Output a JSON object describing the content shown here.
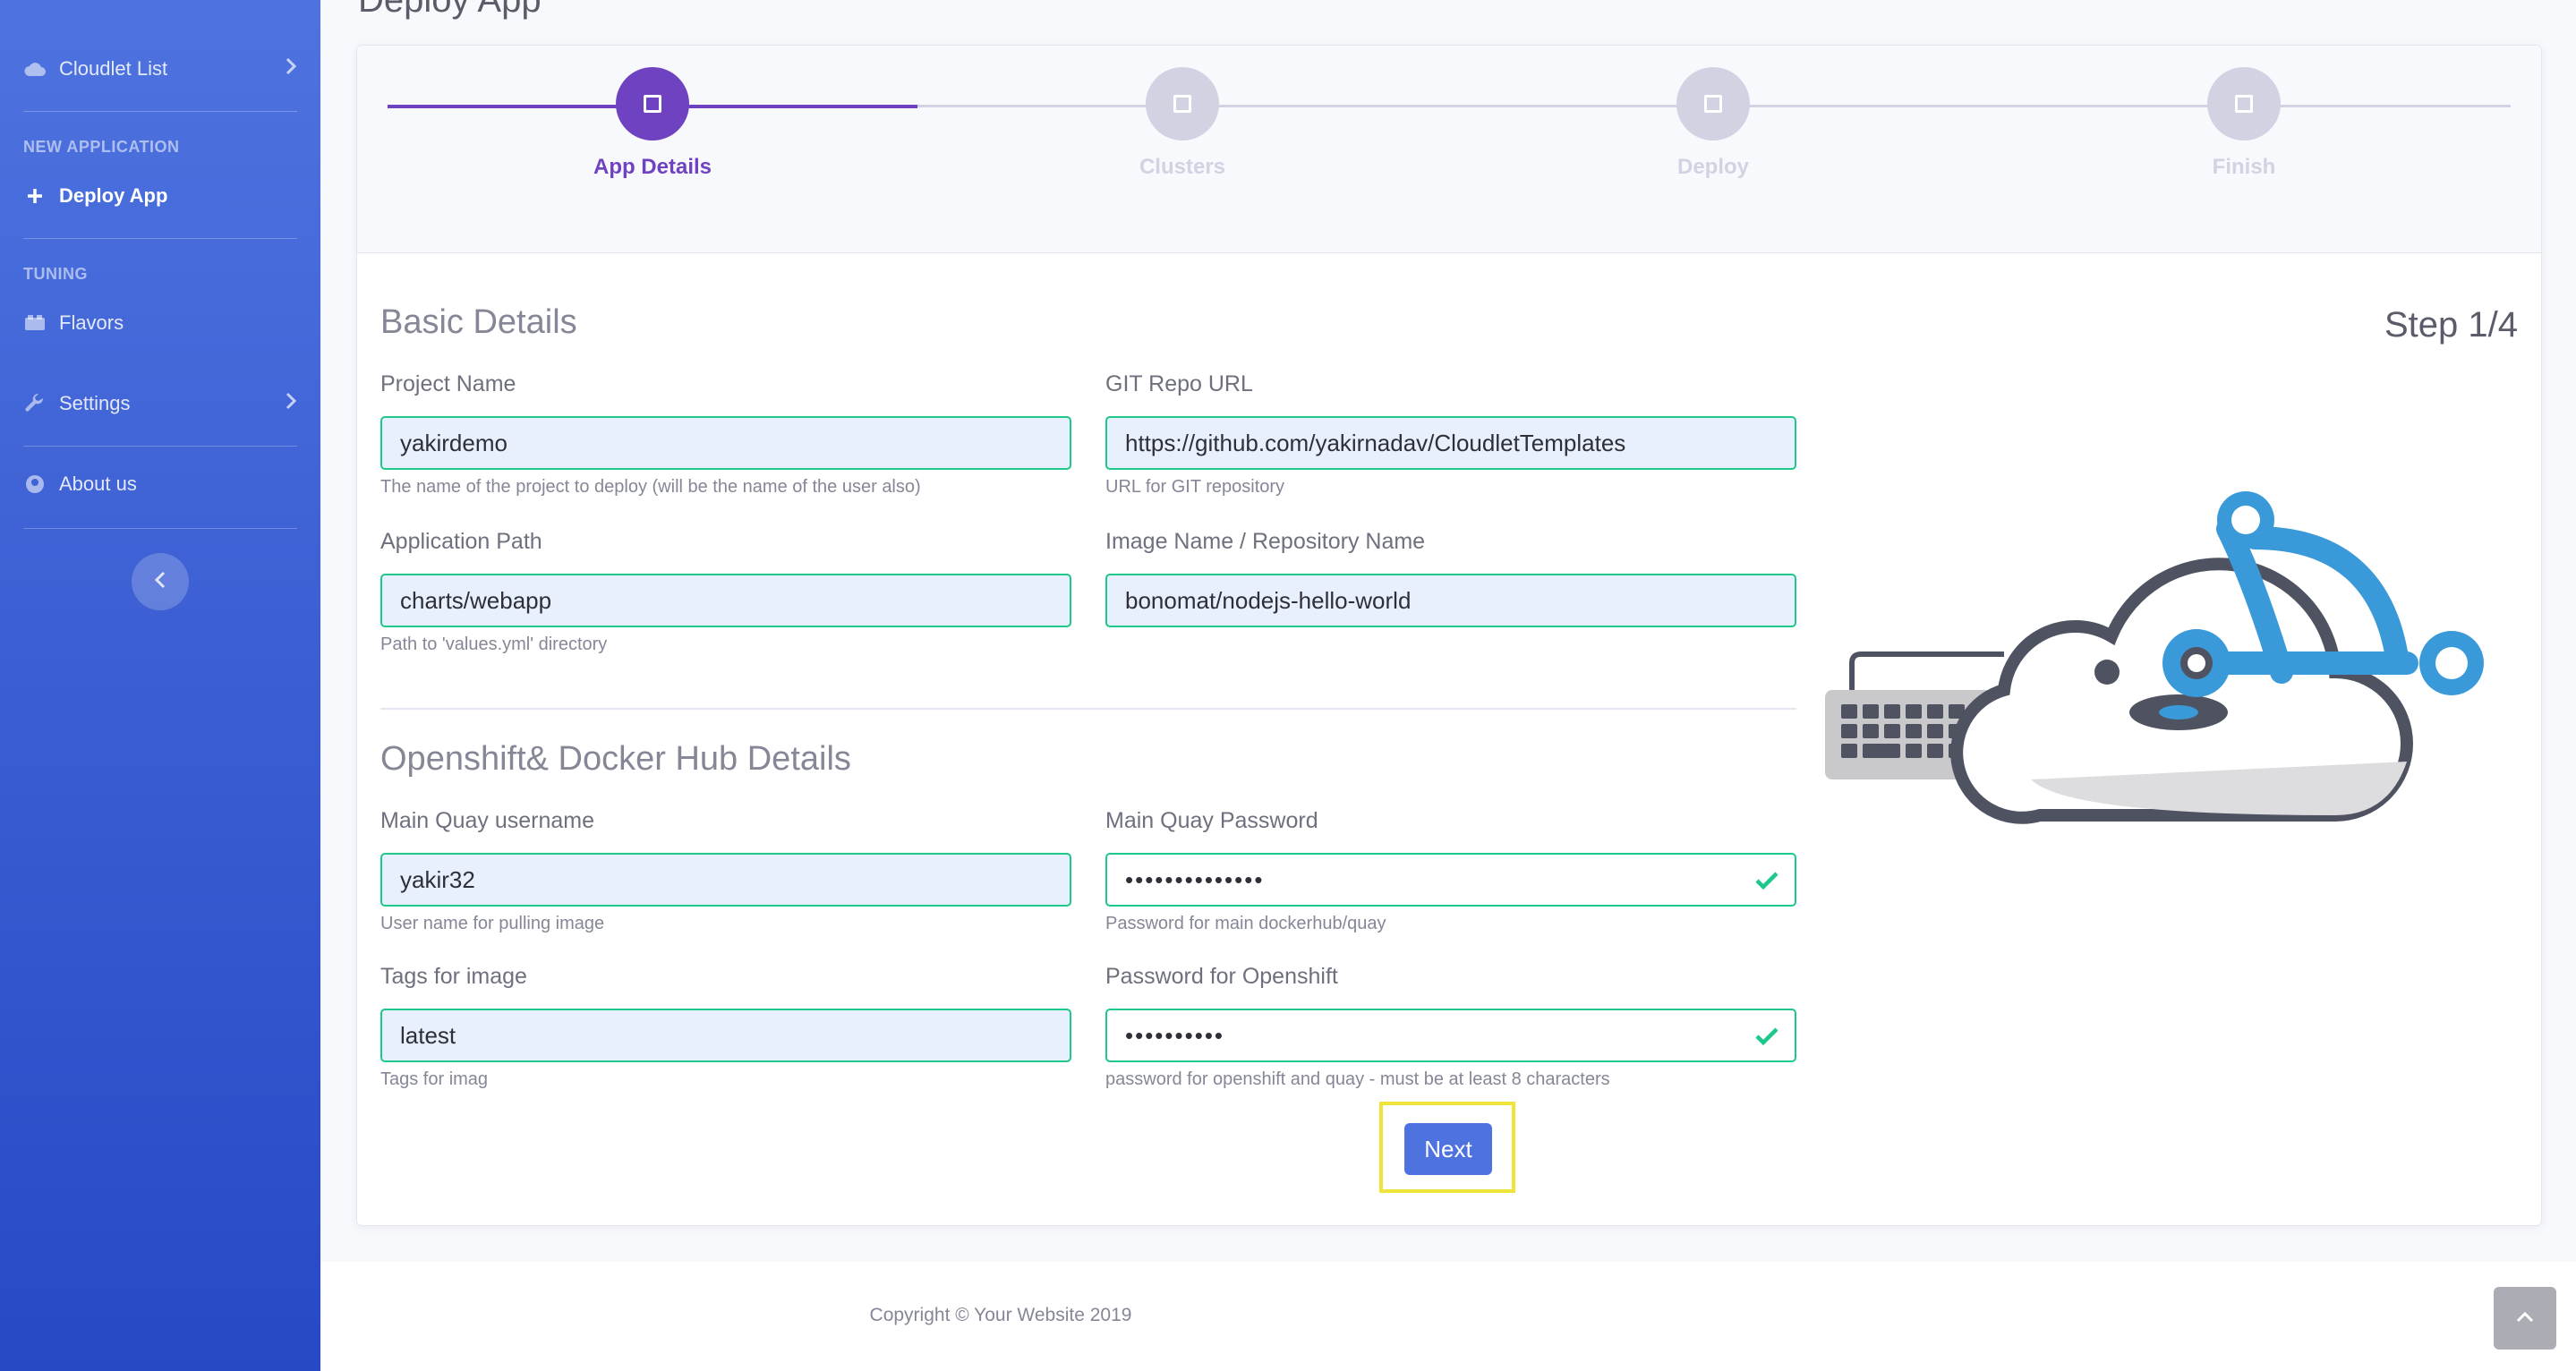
{
  "sidebar": {
    "cloudlet_list": "Cloudlet List",
    "heading_new_application": "NEW APPLICATION",
    "deploy_app": "Deploy App",
    "heading_tuning": "TUNING",
    "flavors": "Flavors",
    "settings": "Settings",
    "about_us": "About us"
  },
  "page": {
    "heading_partial": "Deploy App"
  },
  "stepper": {
    "steps": [
      {
        "label": "App Details",
        "active": true
      },
      {
        "label": "Clusters",
        "active": false
      },
      {
        "label": "Deploy",
        "active": false
      },
      {
        "label": "Finish",
        "active": false
      }
    ],
    "step_count": "Step 1/4"
  },
  "basic": {
    "title": "Basic Details",
    "project_name_label": "Project Name",
    "project_name_value": "yakirdemo",
    "project_name_hint": "The name of the project to deploy (will be the name of the user also)",
    "git_label": "GIT Repo URL",
    "git_value": "https://github.com/yakirnadav/CloudletTemplates",
    "git_hint": "URL for GIT repository",
    "app_path_label": "Application Path",
    "app_path_value": "charts/webapp",
    "app_path_hint": "Path to 'values.yml' directory",
    "image_label": "Image Name / Repository Name",
    "image_value": "bonomat/nodejs-hello-world"
  },
  "openshift": {
    "title": "Openshift& Docker Hub Details",
    "quay_user_label": "Main Quay username",
    "quay_user_value": "yakir32",
    "quay_user_hint": "User name for pulling image",
    "quay_pw_label": "Main Quay Password",
    "quay_pw_value": "••••••••••••••",
    "quay_pw_hint": "Password for main dockerhub/quay",
    "tags_label": "Tags for image",
    "tags_value": "latest",
    "tags_hint": "Tags for imag",
    "os_pw_label": "Password for Openshift",
    "os_pw_value": "••••••••••",
    "os_pw_hint": "password for openshift and quay - must be at least 8 characters"
  },
  "buttons": {
    "next": "Next"
  },
  "footer": {
    "copyright": "Copyright © Your Website 2019"
  },
  "colors": {
    "primary": "#4e73df",
    "step_active": "#6f42c1",
    "valid": "#1cc88a",
    "highlight": "#f0e43a"
  }
}
